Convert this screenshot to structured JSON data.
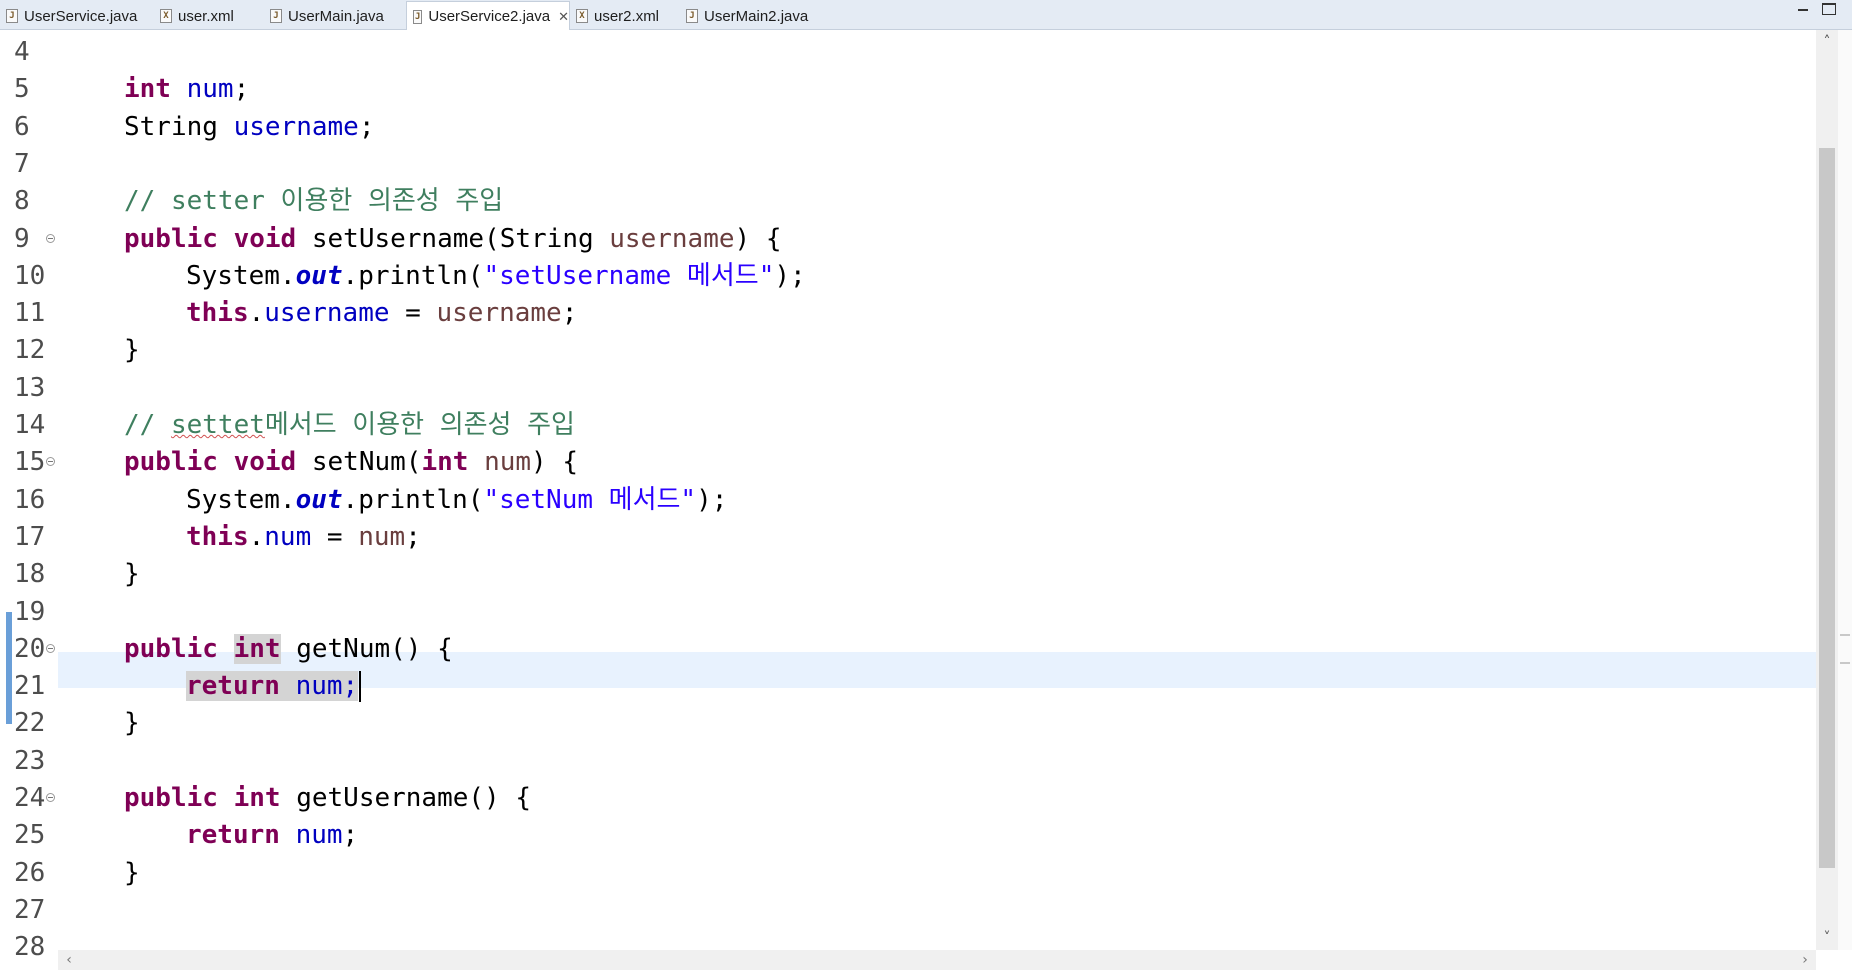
{
  "tabs": [
    {
      "label": "UserService.java",
      "icon": "java-file-icon"
    },
    {
      "label": "user.xml",
      "icon": "xml-file-icon"
    },
    {
      "label": "UserMain.java",
      "icon": "java-file-icon"
    },
    {
      "label": "UserService2.java",
      "icon": "java-file-icon",
      "active": true
    },
    {
      "label": "user2.xml",
      "icon": "xml-file-icon"
    },
    {
      "label": "UserMain2.java",
      "icon": "java-file-icon"
    }
  ],
  "editor": {
    "current_line": 21,
    "colors": {
      "keyword": "#7f0055",
      "field": "#0000c0",
      "string": "#2a00ff",
      "comment": "#3f7f5f",
      "line_highlight": "#e8f2fe"
    },
    "lines": [
      {
        "n": "4",
        "tokens": []
      },
      {
        "n": "5",
        "tokens": [
          [
            "int ",
            "kw"
          ],
          [
            "num",
            "fld"
          ],
          [
            ";",
            ""
          ]
        ]
      },
      {
        "n": "6",
        "tokens": [
          [
            "String ",
            ""
          ],
          [
            "username",
            "fld"
          ],
          [
            ";",
            ""
          ]
        ]
      },
      {
        "n": "7",
        "tokens": []
      },
      {
        "n": "8",
        "tokens": [
          [
            "// setter 이용한 의존성 주입",
            "cmt"
          ]
        ]
      },
      {
        "n": "9",
        "fold": true,
        "tokens": [
          [
            "public ",
            "kw"
          ],
          [
            "void ",
            "kw"
          ],
          [
            "setUsername(String ",
            ""
          ],
          [
            "username",
            "par"
          ],
          [
            ") {",
            ""
          ]
        ]
      },
      {
        "n": "10",
        "indent": 2,
        "tokens": [
          [
            "System.",
            ""
          ],
          [
            "out",
            "sf"
          ],
          [
            ".println(",
            ""
          ],
          [
            "\"setUsername 메서드\"",
            "str"
          ],
          [
            ");",
            ""
          ]
        ]
      },
      {
        "n": "11",
        "indent": 2,
        "tokens": [
          [
            "this",
            "kw"
          ],
          [
            ".",
            ""
          ],
          [
            "username",
            "fld"
          ],
          [
            " = ",
            ""
          ],
          [
            "username",
            "par"
          ],
          [
            ";",
            ""
          ]
        ]
      },
      {
        "n": "12",
        "tokens": [
          [
            "}",
            ""
          ]
        ]
      },
      {
        "n": "13",
        "tokens": []
      },
      {
        "n": "14",
        "tokens": [
          [
            "// ",
            "cmt"
          ],
          [
            "settet",
            "cmt typo"
          ],
          [
            "메서드 이용한 의존성 주입",
            "cmt"
          ]
        ]
      },
      {
        "n": "15",
        "fold": true,
        "tokens": [
          [
            "public ",
            "kw"
          ],
          [
            "void ",
            "kw"
          ],
          [
            "setNum(",
            ""
          ],
          [
            "int ",
            "kw"
          ],
          [
            "num",
            "par"
          ],
          [
            ") {",
            ""
          ]
        ]
      },
      {
        "n": "16",
        "indent": 2,
        "tokens": [
          [
            "System.",
            ""
          ],
          [
            "out",
            "sf"
          ],
          [
            ".println(",
            ""
          ],
          [
            "\"setNum 메서드\"",
            "str"
          ],
          [
            ");",
            ""
          ]
        ]
      },
      {
        "n": "17",
        "indent": 2,
        "tokens": [
          [
            "this",
            "kw"
          ],
          [
            ".",
            ""
          ],
          [
            "num",
            "fld"
          ],
          [
            " = ",
            ""
          ],
          [
            "num",
            "par"
          ],
          [
            ";",
            ""
          ]
        ]
      },
      {
        "n": "18",
        "tokens": [
          [
            "}",
            ""
          ]
        ]
      },
      {
        "n": "19",
        "tokens": []
      },
      {
        "n": "20",
        "fold": true,
        "tokens": [
          [
            "public ",
            "kw"
          ],
          [
            "int",
            "kw occ"
          ],
          [
            " getNum() {",
            ""
          ]
        ]
      },
      {
        "n": "21",
        "indent": 2,
        "caret": true,
        "tokens": [
          [
            "return ",
            "kw occ"
          ],
          [
            "num;",
            "fld occ"
          ]
        ]
      },
      {
        "n": "22",
        "tokens": [
          [
            "}",
            ""
          ]
        ]
      },
      {
        "n": "23",
        "tokens": []
      },
      {
        "n": "24",
        "fold": true,
        "tokens": [
          [
            "public ",
            "kw"
          ],
          [
            "int ",
            "kw"
          ],
          [
            "getUsername() {",
            ""
          ]
        ]
      },
      {
        "n": "25",
        "indent": 2,
        "tokens": [
          [
            "return ",
            "kw"
          ],
          [
            "num",
            "fld"
          ],
          [
            ";",
            ""
          ]
        ]
      },
      {
        "n": "26",
        "tokens": [
          [
            "}",
            ""
          ]
        ]
      },
      {
        "n": "27",
        "tokens": []
      },
      {
        "n": "28",
        "tokens": []
      }
    ]
  }
}
